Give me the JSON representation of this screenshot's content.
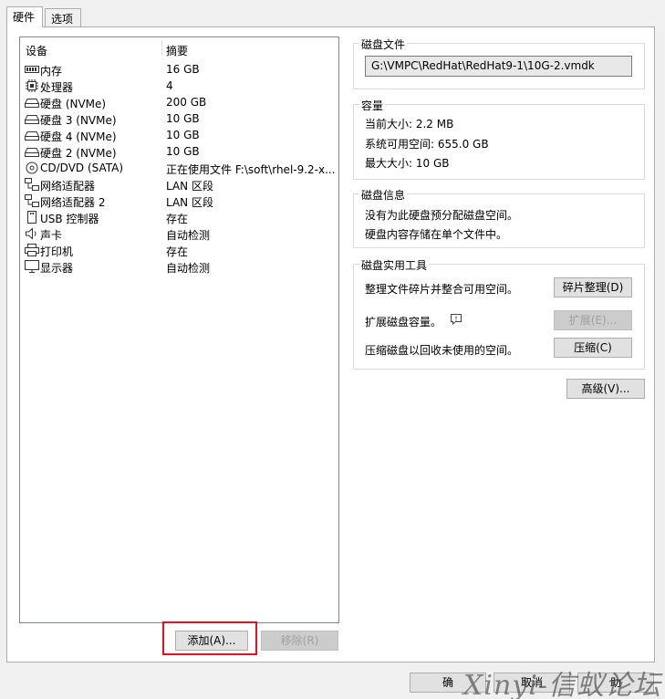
{
  "tabs": [
    {
      "label": "硬件"
    },
    {
      "label": "选项"
    }
  ],
  "device_list": {
    "headers": {
      "device": "设备",
      "summary": "摘要"
    },
    "items": [
      {
        "name": "内存",
        "summary": "16 GB",
        "icon": "memory-icon"
      },
      {
        "name": "处理器",
        "summary": "4",
        "icon": "cpu-icon"
      },
      {
        "name": "硬盘 (NVMe)",
        "summary": "200 GB",
        "icon": "harddisk-icon"
      },
      {
        "name": "硬盘 3 (NVMe)",
        "summary": "10 GB",
        "icon": "harddisk-icon"
      },
      {
        "name": "硬盘 4 (NVMe)",
        "summary": "10 GB",
        "icon": "harddisk-icon"
      },
      {
        "name": "硬盘 2 (NVMe)",
        "summary": "10 GB",
        "icon": "harddisk-icon"
      },
      {
        "name": "CD/DVD (SATA)",
        "summary": "正在使用文件 F:\\soft\\rhel-9.2-x...",
        "icon": "cdrom-icon"
      },
      {
        "name": "网络适配器",
        "summary": "LAN 区段",
        "icon": "network-icon"
      },
      {
        "name": "网络适配器 2",
        "summary": "LAN 区段",
        "icon": "network-icon"
      },
      {
        "name": "USB 控制器",
        "summary": "存在",
        "icon": "usb-icon"
      },
      {
        "name": "声卡",
        "summary": "自动检测",
        "icon": "sound-icon"
      },
      {
        "name": "打印机",
        "summary": "存在",
        "icon": "printer-icon"
      },
      {
        "name": "显示器",
        "summary": "自动检测",
        "icon": "display-icon"
      }
    ]
  },
  "buttons": {
    "add": "添加(A)...",
    "remove": "移除(R)",
    "defrag": "碎片整理(D)",
    "expand": "扩展(E)...",
    "compact": "压缩(C)",
    "advanced": "高级(V)..."
  },
  "disk_file": {
    "title": "磁盘文件",
    "path": "G:\\VMPC\\RedHat\\RedHat9-1\\10G-2.vmdk"
  },
  "capacity": {
    "title": "容量",
    "current": "当前大小: 2.2 MB",
    "available": "系统可用空间: 655.0 GB",
    "max": "最大大小: 10 GB"
  },
  "disk_info": {
    "title": "磁盘信息",
    "line1": "没有为此硬盘预分配磁盘空间。",
    "line2": "硬盘内容存储在单个文件中。"
  },
  "disk_utility": {
    "title": "磁盘实用工具",
    "defrag_text": "整理文件碎片并整合可用空间。",
    "expand_text": "扩展磁盘容量。",
    "compact_text": "压缩磁盘以回收未使用的空间。"
  },
  "footer": {
    "ok_partial": "确",
    "cancel_partial": "取消",
    "help_partial": "助"
  },
  "watermark": "Xinyi-信蚁论坛",
  "colors": {
    "highlight_border": "#e81123"
  }
}
